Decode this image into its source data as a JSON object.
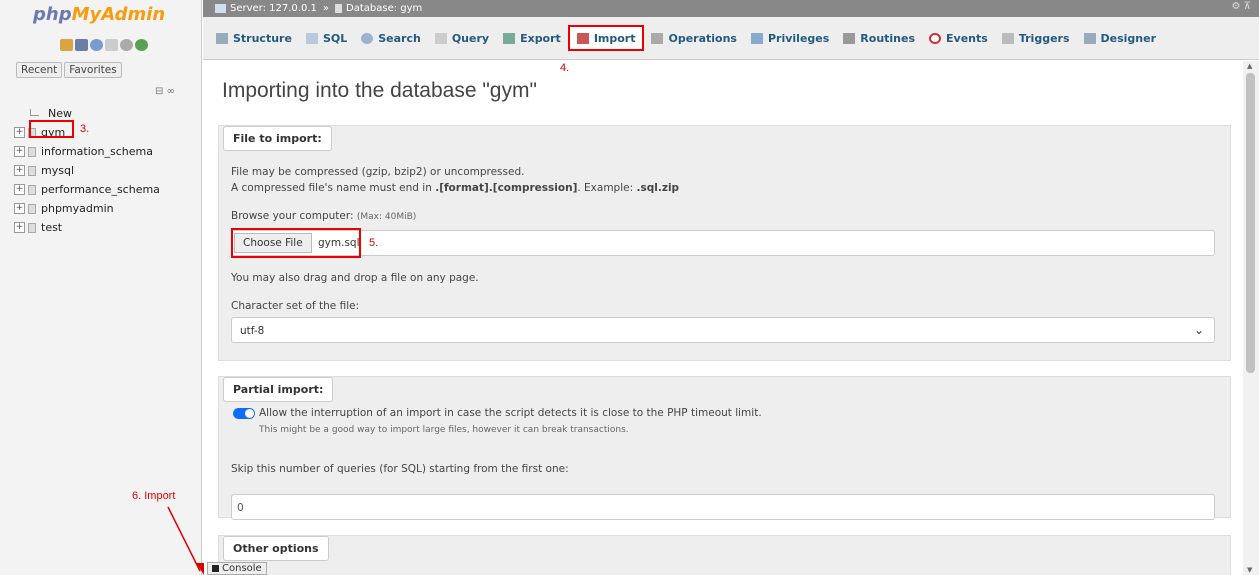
{
  "logo": {
    "part1": "php",
    "part2": "MyAdmin"
  },
  "nav": {
    "recent_label": "Recent",
    "favorites_label": "Favorites",
    "new_label": "New",
    "databases": [
      "gym",
      "information_schema",
      "mysql",
      "performance_schema",
      "phpmyadmin",
      "test"
    ]
  },
  "breadcrumb": {
    "server": "Server: 127.0.0.1",
    "sep": "»",
    "database": "Database: gym"
  },
  "tabs": [
    {
      "label": "Structure",
      "icon": "structure-icon"
    },
    {
      "label": "SQL",
      "icon": "sql-icon"
    },
    {
      "label": "Search",
      "icon": "search-icon"
    },
    {
      "label": "Query",
      "icon": "query-icon"
    },
    {
      "label": "Export",
      "icon": "export-icon"
    },
    {
      "label": "Import",
      "icon": "import-icon",
      "active": true
    },
    {
      "label": "Operations",
      "icon": "operations-icon"
    },
    {
      "label": "Privileges",
      "icon": "privileges-icon"
    },
    {
      "label": "Routines",
      "icon": "routines-icon"
    },
    {
      "label": "Events",
      "icon": "events-icon"
    },
    {
      "label": "Triggers",
      "icon": "triggers-icon"
    },
    {
      "label": "Designer",
      "icon": "designer-icon"
    }
  ],
  "main": {
    "title": "Importing into the database \"gym\"",
    "file_to_import": {
      "legend": "File to import:",
      "line1": "File may be compressed (gzip, bzip2) or uncompressed.",
      "line2_prefix": "A compressed file's name must end in ",
      "line2_bold": ".[format].[compression]",
      "line2_mid": ". Example: ",
      "line2_example": ".sql.zip",
      "browse_label": "Browse your computer:",
      "browse_max": "(Max: 40MiB)",
      "choose_button": "Choose File",
      "file_name": "gym.sql",
      "drag_text": "You may also drag and drop a file on any page.",
      "charset_label": "Character set of the file:",
      "charset_value": "utf-8"
    },
    "partial_import": {
      "legend": "Partial import:",
      "allow_interrupt": "Allow the interruption of an import in case the script detects it is close to the PHP timeout limit.",
      "allow_interrupt_note": "This might be a good way to import large files, however it can break transactions.",
      "skip_label": "Skip this number of queries (for SQL) starting from the first one:",
      "skip_value": "0"
    },
    "other_options": {
      "legend": "Other options"
    }
  },
  "console_label": "Console",
  "annotations": {
    "a3": "3.",
    "a4": "4.",
    "a5": "5.",
    "a6": "6. Import"
  },
  "colors": {
    "highlight": "#e00000",
    "tab_text": "#235a81",
    "toggle": "#0d6efd"
  }
}
